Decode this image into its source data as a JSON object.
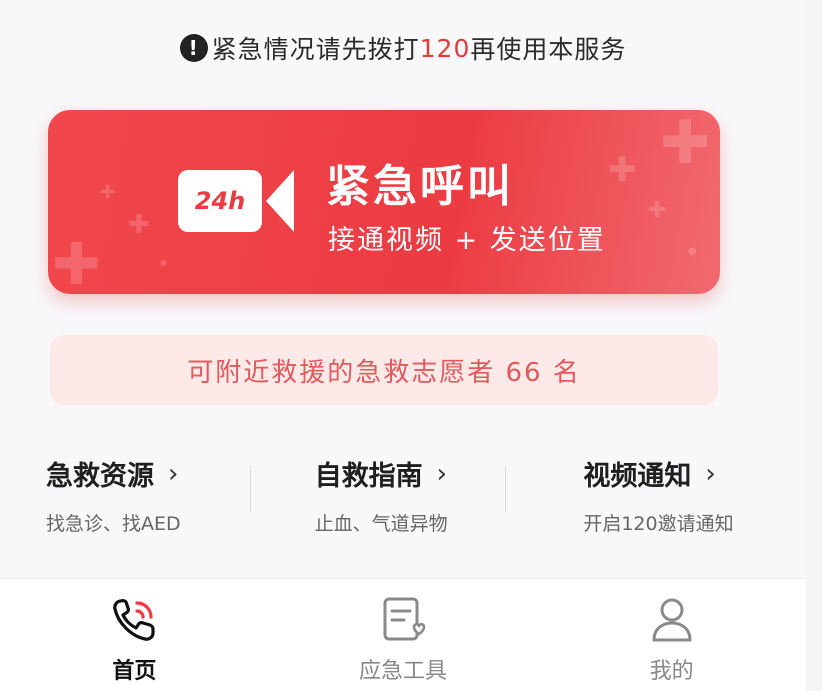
{
  "notice": {
    "icon": "exclamation-icon",
    "prefix": "紧急情况请先拨打",
    "number": "120",
    "suffix": "再使用本服务",
    "accent_color": "#e33a3a"
  },
  "hero": {
    "icon": "video-camera-24h-icon",
    "icon_text": "24h",
    "title": "紧急呼叫",
    "subtitle": "接通视频 + 发送位置",
    "color": "#ec3b42"
  },
  "volunteer": {
    "text": "可附近救援的急救志愿者 66 名",
    "color": "#e2595b"
  },
  "resources": [
    {
      "title": "急救资源",
      "chevron": "›",
      "subtitle": "找急诊、找AED"
    },
    {
      "title": "自救指南",
      "chevron": "›",
      "subtitle": "止血、气道异物"
    },
    {
      "title": "视频通知",
      "chevron": "›",
      "subtitle": "开启120邀请通知"
    }
  ],
  "tabbar": {
    "tabs": [
      {
        "label": "首页",
        "icon": "phone-call-icon",
        "active": true
      },
      {
        "label": "应急工具",
        "icon": "document-heart-icon",
        "active": false
      },
      {
        "label": "我的",
        "icon": "user-icon",
        "active": false
      }
    ]
  }
}
